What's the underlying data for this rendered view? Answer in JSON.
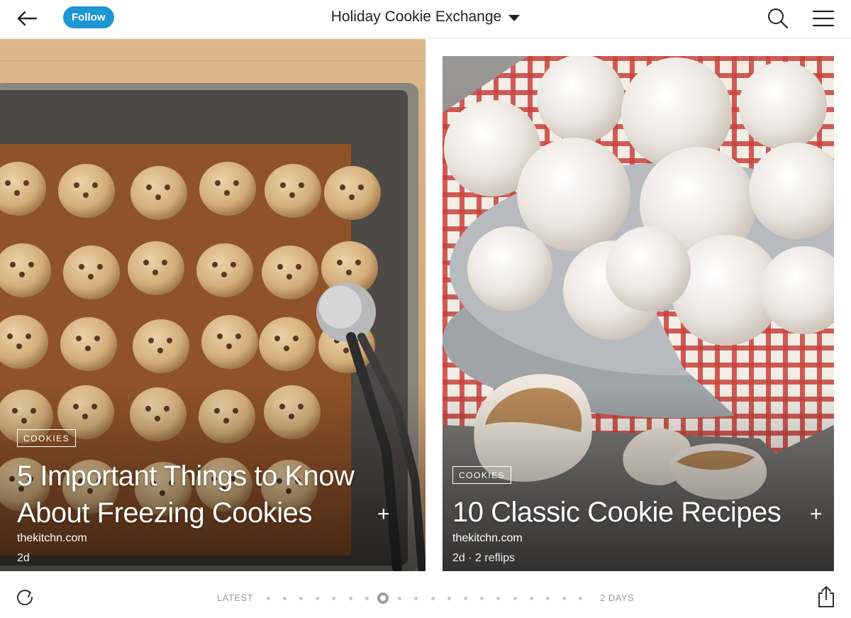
{
  "header": {
    "follow_label": "Follow",
    "title": "Holiday Cookie Exchange"
  },
  "cards": [
    {
      "tag": "COOKIES",
      "headline_line1": "5 Important Things to Know",
      "headline_line2": "About Freezing Cookies",
      "source": "thekitchn.com",
      "meta": "2d",
      "add_label": "+"
    },
    {
      "tag": "COOKIES",
      "headline_line1": "10 Classic Cookie Recipes",
      "source": "thekitchn.com",
      "meta": "2d · 2 reflips",
      "add_label": "+"
    }
  ],
  "timeline": {
    "start_label": "LATEST",
    "end_label": "2 DAYS",
    "dot_count": 20,
    "active_index": 7
  },
  "colors": {
    "accent": "#1e96d4",
    "text": "#222222",
    "muted": "#9a9a9a"
  },
  "icons": [
    "back-arrow-icon",
    "search-icon",
    "menu-icon",
    "refresh-icon",
    "share-icon"
  ]
}
